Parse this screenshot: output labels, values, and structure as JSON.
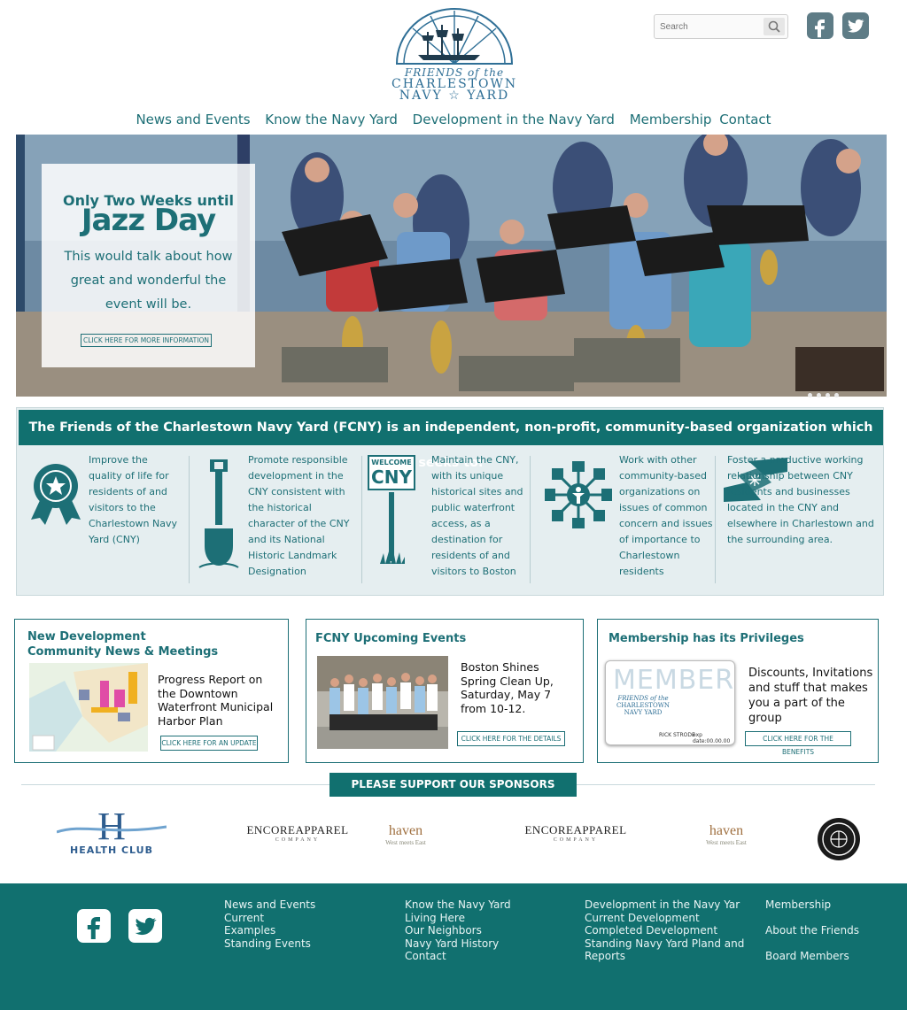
{
  "header": {
    "logo": {
      "line1": "FRIENDS of the",
      "line2": "CHARLESTOWN",
      "line3": "NAVY",
      "line3b": "YARD"
    },
    "search": {
      "placeholder": "Search"
    },
    "social": [
      "facebook-icon",
      "twitter-icon"
    ]
  },
  "nav": [
    "News and Events",
    "Know the Navy Yard",
    "Development in the Navy Yard",
    "Membership",
    "Contact"
  ],
  "hero": {
    "kicker": "Only Two Weeks until",
    "title": "Jazz Day",
    "body": "This would talk about how great and wonderful the event will be.",
    "button": "CLICK HERE FOR MORE INFORMATION",
    "slide_count": 4
  },
  "mission": {
    "headline": "The Friends of the Charlestown Navy Yard (FCNY) is an independent, non-profit, community-based organization which seeks to:",
    "sign_text_top": "WELCOME",
    "sign_text_main": "CNY",
    "items": [
      {
        "icon": "ribbon-icon",
        "text": "Improve the quality of life for residents of and visitors to the Charlestown Navy Yard (CNY)"
      },
      {
        "icon": "shovel-icon",
        "text": "Promote responsible development in the CNY consistent with the historical character of the CNY and its National Historic Landmark Designation"
      },
      {
        "icon": "welcome-sign-icon",
        "text": "Maintain the CNY, with its unique historical sites and public waterfront access, as a destination for residents of and visitors to Boston"
      },
      {
        "icon": "network-icon",
        "text": "Work with other community-based organizations on issues of common concern and issues of importance to Charlestown residents"
      },
      {
        "icon": "handshake-icon",
        "text": "Foster a productive working relationship between CNY residents and businesses located in the CNY and elsewhere in Charlestown and the surrounding area."
      }
    ]
  },
  "boxes": {
    "dev": {
      "title1": "New Development",
      "title2": "Community News & Meetings",
      "text": "Progress Report on the Downtown Waterfront Municipal Harbor Plan",
      "button": "CLICK HERE FOR AN UPDATE"
    },
    "events": {
      "title": "FCNY Upcoming Events",
      "text": "Boston Shines Spring Clean Up, Saturday, May 7 from 10-12.",
      "button": "CLICK HERE FOR THE DETAILS"
    },
    "membership": {
      "title": "Membership has its Privileges",
      "card_watermark": "MEMBER",
      "card_name": "RICK STRODE",
      "card_exp": "exp date:00.00.00",
      "text": "Discounts, Invitations and stuff that makes you a part of the group",
      "button": "CLICK HERE FOR THE BENEFITS"
    }
  },
  "sponsors": {
    "heading": "PLEASE SUPPORT OUR SPONSORS",
    "health_club_letter": "H",
    "health_club": "HEALTH CLUB",
    "encore1": "ENCOREAPPAREL",
    "encore2": "COMPANY",
    "haven": "haven",
    "haven_tag": "West meets East"
  },
  "footer": {
    "col1": [
      "News and Events",
      "Current",
      "Examples",
      "Standing Events"
    ],
    "col2": [
      "Know the Navy Yard",
      "Living Here",
      "Our Neighbors",
      "Navy Yard History",
      "Contact"
    ],
    "col3": [
      "Development in the Navy Yar",
      "Current Development",
      "Completed Development",
      "Standing Navy Yard Pland and",
      "Reports"
    ],
    "col4": [
      "Membership",
      "About the Friends",
      "Board Members"
    ]
  }
}
